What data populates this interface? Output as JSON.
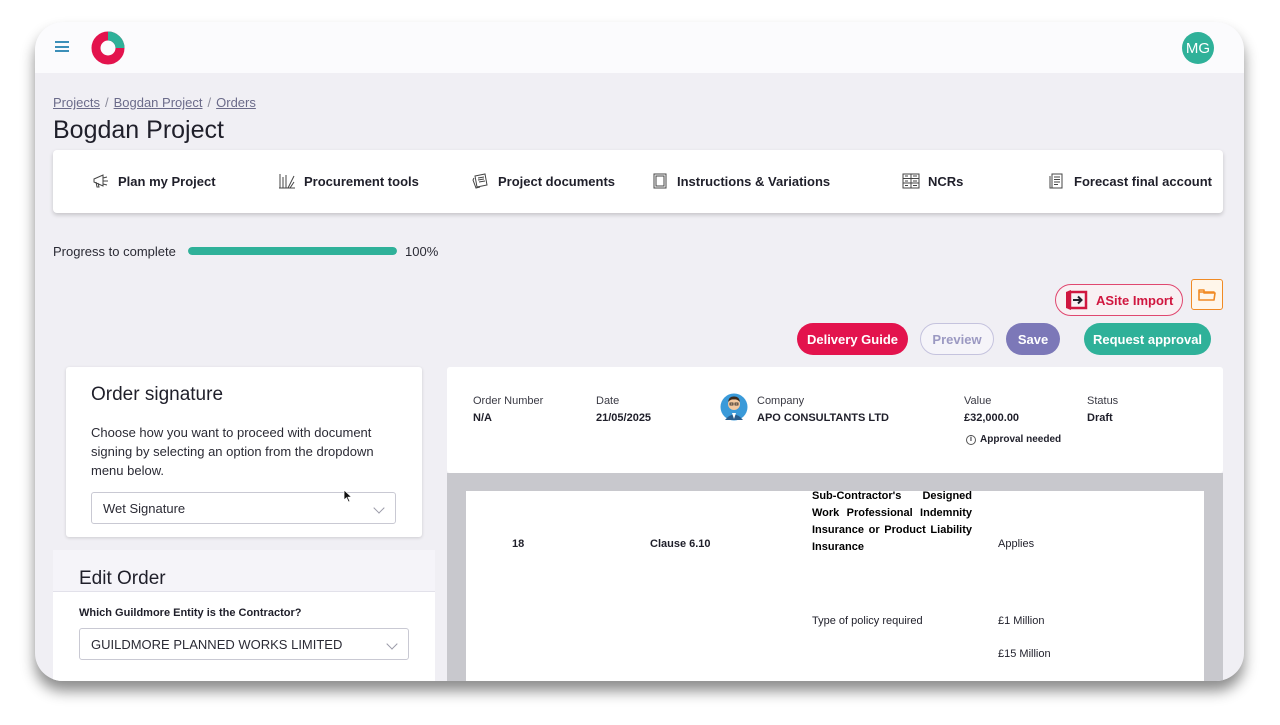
{
  "topbar": {
    "user_initials": "MG"
  },
  "breadcrumb": [
    "Projects",
    "Bogdan Project",
    "Orders"
  ],
  "page_title": "Bogdan Project",
  "tools": [
    {
      "label": "Plan my Project",
      "icon": "megaphone-icon"
    },
    {
      "label": "Procurement tools",
      "icon": "tools-icon"
    },
    {
      "label": "Project documents",
      "icon": "documents-icon"
    },
    {
      "label": "Instructions & Variations",
      "icon": "clipboard-icon"
    },
    {
      "label": "NCRs",
      "icon": "checklist-icon"
    },
    {
      "label": "Forecast final account",
      "icon": "report-icon"
    }
  ],
  "progress": {
    "label": "Progress to complete",
    "value": 100,
    "text": "100%"
  },
  "actions": {
    "asite_import": "ASite Import",
    "delivery_guide": "Delivery Guide",
    "preview": "Preview",
    "save": "Save",
    "request_approval": "Request approval"
  },
  "signature": {
    "title": "Order signature",
    "description": "Choose how you want to proceed with document signing by selecting an option from the dropdown menu below.",
    "selected": "Wet Signature"
  },
  "edit_order": {
    "title": "Edit Order",
    "entity_label": "Which Guildmore Entity is the Contractor?",
    "entity_selected": "GUILDMORE PLANNED WORKS LIMITED"
  },
  "order_summary": {
    "order_number_label": "Order Number",
    "order_number": "N/A",
    "date_label": "Date",
    "date": "21/05/2025",
    "company_label": "Company",
    "company": "APO CONSULTANTS LTD",
    "value_label": "Value",
    "value": "£32,000.00",
    "approval_note": "Approval needed",
    "status_label": "Status",
    "status": "Draft"
  },
  "document": {
    "row_number": "18",
    "clause": "Clause 6.10",
    "insurance_title": "Sub-Contractor's Designed Work Professional Indemnity Insurance or Product Liability Insurance",
    "applies": "Applies",
    "policy_label": "Type of policy required",
    "amount_1": "£1 Million",
    "amount_2": "£15 Million"
  },
  "colors": {
    "accent_teal": "#2fb199",
    "accent_red": "#e3134d",
    "accent_purple": "#7c78b8",
    "accent_orange": "#f08a24"
  }
}
